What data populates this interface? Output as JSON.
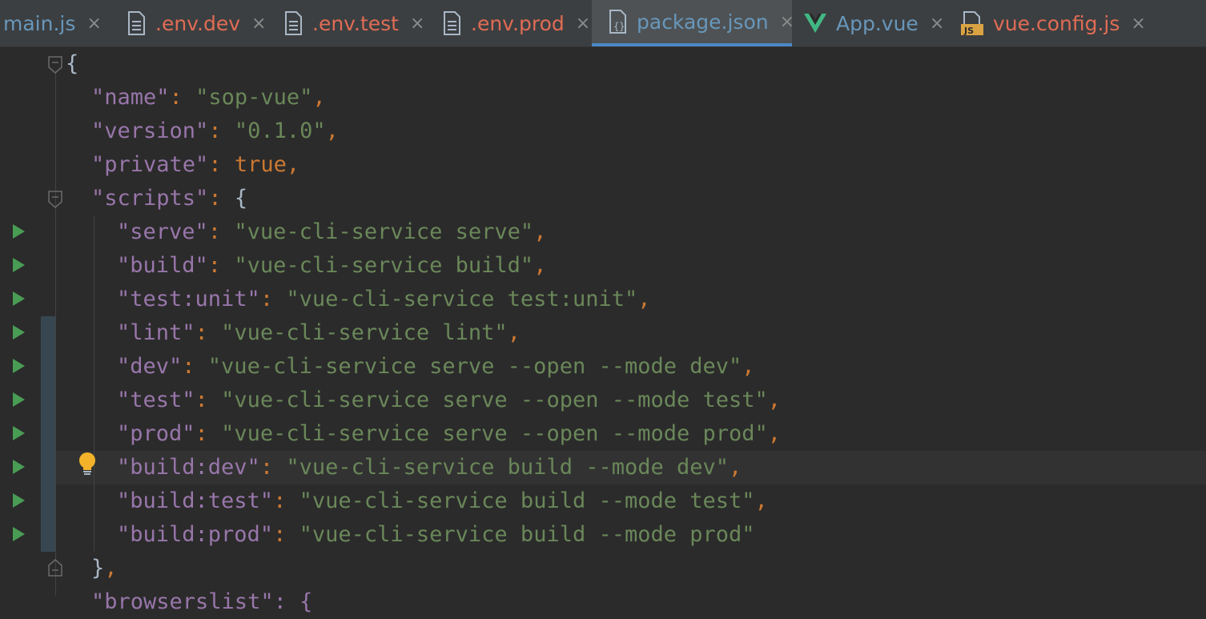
{
  "tabs": [
    {
      "label": "main.js",
      "icon": "javascript-file-icon",
      "color": "#6897bb",
      "active": false
    },
    {
      "label": ".env.dev",
      "icon": "text-file-icon",
      "color": "#e06c55",
      "active": false
    },
    {
      "label": ".env.test",
      "icon": "text-file-icon",
      "color": "#e06c55",
      "active": false
    },
    {
      "label": ".env.prod",
      "icon": "text-file-icon",
      "color": "#e06c55",
      "active": false
    },
    {
      "label": "package.json",
      "icon": "json-file-icon",
      "color": "#6897bb",
      "active": true
    },
    {
      "label": "App.vue",
      "icon": "vue-file-icon",
      "color": "#6897bb",
      "active": false
    },
    {
      "label": "vue.config.js",
      "icon": "javascript-file-icon",
      "color": "#e06c55",
      "active": false
    }
  ],
  "close_glyph": "×",
  "code": {
    "open_brace": "{",
    "name_key": "\"name\"",
    "name_value": "\"sop-vue\"",
    "version_key": "\"version\"",
    "version_value": "\"0.1.0\"",
    "private_key": "\"private\"",
    "private_value": "true",
    "scripts_key": "\"scripts\"",
    "scripts_open": "{",
    "scripts": [
      {
        "key": "\"serve\"",
        "value": "\"vue-cli-service serve\"",
        "comma": ","
      },
      {
        "key": "\"build\"",
        "value": "\"vue-cli-service build\"",
        "comma": ","
      },
      {
        "key": "\"test:unit\"",
        "value": "\"vue-cli-service test:unit\"",
        "comma": ","
      },
      {
        "key": "\"lint\"",
        "value": "\"vue-cli-service lint\"",
        "comma": ","
      },
      {
        "key": "\"dev\"",
        "value": "\"vue-cli-service serve --open --mode dev\"",
        "comma": ","
      },
      {
        "key": "\"test\"",
        "value": "\"vue-cli-service serve --open --mode test\"",
        "comma": ","
      },
      {
        "key": "\"prod\"",
        "value": "\"vue-cli-service serve --open --mode prod\"",
        "comma": ","
      },
      {
        "key": "\"build:dev\"",
        "value": "\"vue-cli-service build --mode dev\"",
        "comma": ","
      },
      {
        "key": "\"build:test\"",
        "value": "\"vue-cli-service build --mode test\"",
        "comma": ","
      },
      {
        "key": "\"build:prod\"",
        "value": "\"vue-cli-service build --mode prod\"",
        "comma": ""
      }
    ],
    "scripts_close": "}",
    "colon": ": ",
    "comma": ",",
    "partial_line": "\"browserslist\": {"
  },
  "colors": {
    "background": "#2b2b2b",
    "key": "#9876aa",
    "string": "#6a8759",
    "punctuation": "#cc7832",
    "run_gutter": "#499c54",
    "active_tab_underline": "#4a88c7"
  }
}
